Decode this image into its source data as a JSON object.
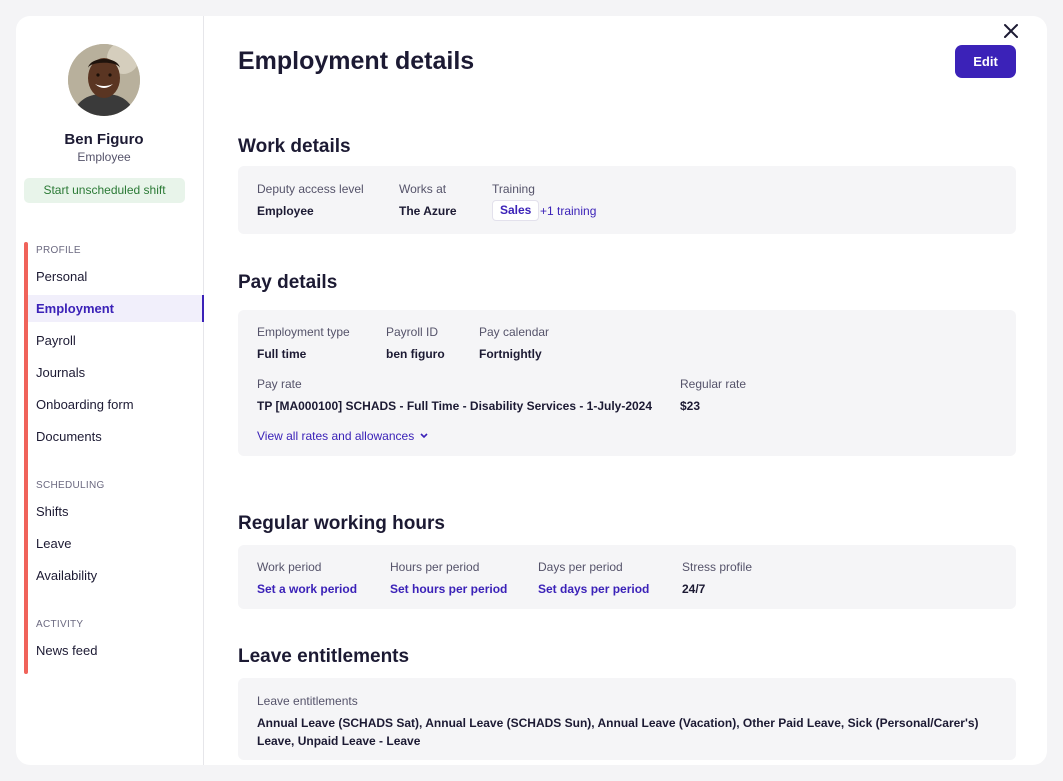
{
  "profile": {
    "name": "Ben Figuro",
    "role": "Employee",
    "shift_button": "Start unscheduled shift"
  },
  "sidebar": {
    "sections": [
      {
        "label": "PROFILE",
        "items": [
          "Personal",
          "Employment",
          "Payroll",
          "Journals",
          "Onboarding form",
          "Documents"
        ]
      },
      {
        "label": "SCHEDULING",
        "items": [
          "Shifts",
          "Leave",
          "Availability"
        ]
      },
      {
        "label": "ACTIVITY",
        "items": [
          "News feed"
        ]
      }
    ],
    "active_item": "Employment"
  },
  "header": {
    "title": "Employment details",
    "edit_label": "Edit"
  },
  "work_details": {
    "title": "Work details",
    "access_label": "Deputy access level",
    "access_value": "Employee",
    "works_at_label": "Works at",
    "works_at_value": "The Azure",
    "training_label": "Training",
    "training_chip": "Sales",
    "training_more": "+1 training"
  },
  "pay_details": {
    "title": "Pay details",
    "employment_type_label": "Employment type",
    "employment_type_value": "Full time",
    "payroll_id_label": "Payroll ID",
    "payroll_id_value": "ben figuro",
    "pay_calendar_label": "Pay calendar",
    "pay_calendar_value": "Fortnightly",
    "pay_rate_label": "Pay rate",
    "pay_rate_value": "TP [MA000100] SCHADS - Full Time - Disability Services - 1-July-2024",
    "regular_rate_label": "Regular rate",
    "regular_rate_value": "$23",
    "view_all_link": "View all rates and allowances"
  },
  "working_hours": {
    "title": "Regular working hours",
    "work_period_label": "Work period",
    "work_period_value": "Set a work period",
    "hours_label": "Hours per period",
    "hours_value": "Set hours per period",
    "days_label": "Days per period",
    "days_value": "Set days per period",
    "stress_label": "Stress profile",
    "stress_value": "24/7"
  },
  "leave": {
    "title": "Leave entitlements",
    "label": "Leave entitlements",
    "value": "Annual Leave (SCHADS Sat), Annual Leave (SCHADS Sun), Annual Leave (Vacation), Other Paid Leave, Sick (Personal/Carer's) Leave, Unpaid Leave - Leave"
  },
  "colors": {
    "accent": "#3b22b8",
    "sidebar_marker": "#f0635a",
    "shift_button_bg": "#e8f4ea",
    "shift_button_text": "#2b7a36"
  },
  "icons": {
    "close": "close-icon",
    "chevron": "chevron-down-icon",
    "avatar": "avatar"
  }
}
